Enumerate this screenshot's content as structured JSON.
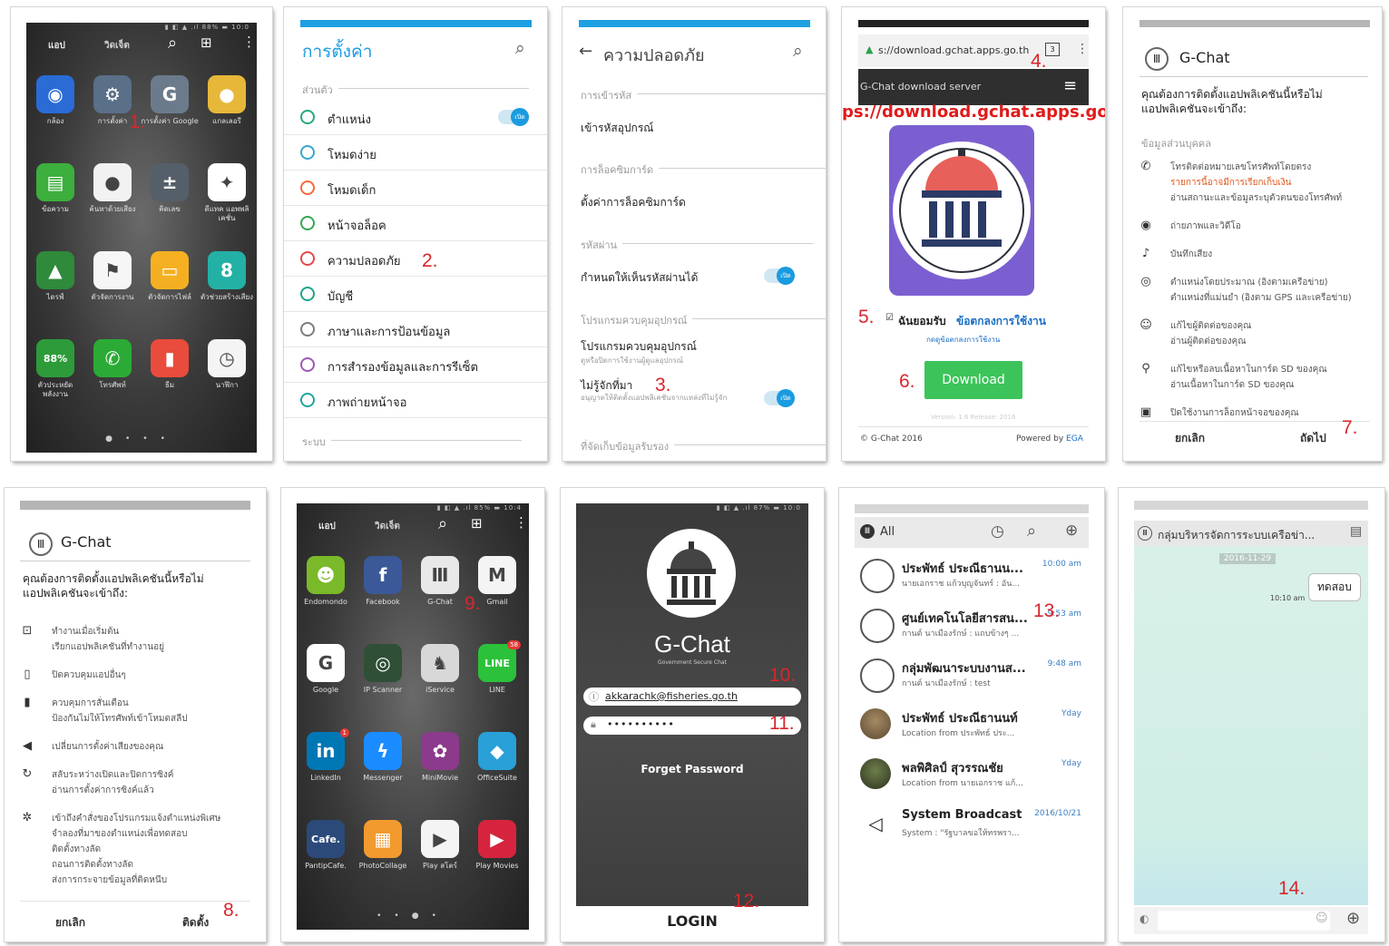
{
  "steps": {
    "s1": "1.",
    "s2": "2.",
    "s3": "3.",
    "s4": "4.",
    "s5": "5.",
    "s6": "6.",
    "s7": "7.",
    "s8": "8.",
    "s9": "9.",
    "s10": "10.",
    "s11": "11.",
    "s12": "12.",
    "s13": "13.",
    "s14": "14."
  },
  "launcher1": {
    "tab_apps": "แอป",
    "tab_widgets": "วิดเจ็ต",
    "apps": [
      {
        "label": "กล้อง",
        "color": "#2a6bd6",
        "glyph": "◉"
      },
      {
        "label": "การตั้งค่า",
        "color": "#5a6f88",
        "glyph": "⚙"
      },
      {
        "label": "การตั้งค่า Google",
        "color": "#6b7b8c",
        "glyph": "G"
      },
      {
        "label": "แกลเลอรี",
        "color": "#e7b73a",
        "glyph": "●"
      },
      {
        "label": "ข้อความ",
        "color": "#3daf3d",
        "glyph": "▤"
      },
      {
        "label": "ค้นหาด้วยเสียง",
        "color": "#f2f2f2",
        "glyph": "●"
      },
      {
        "label": "คิดเลข",
        "color": "#555f6a",
        "glyph": "±"
      },
      {
        "label": "ดีแทค แอพพลิเคชั่น",
        "color": "#ffffff",
        "glyph": "✦"
      },
      {
        "label": "ไดรฟ์",
        "color": "#2f8a3b",
        "glyph": "▲"
      },
      {
        "label": "ตัวจัดการงาน",
        "color": "#f6f6f6",
        "glyph": "⚑"
      },
      {
        "label": "ตัวจัดการไฟล์",
        "color": "#f5b021",
        "glyph": "▭"
      },
      {
        "label": "ตัวช่วยสร้างเสียง",
        "color": "#23b0a5",
        "glyph": "8"
      },
      {
        "label": "ตัวประหยัดพลังงาน",
        "color": "#2d9b3a",
        "glyph": "88%"
      },
      {
        "label": "โทรศัพท์",
        "color": "#2bab35",
        "glyph": "✆"
      },
      {
        "label": "ธีม",
        "color": "#e94b3c",
        "glyph": "▮"
      },
      {
        "label": "นาฬิกา",
        "color": "#f4f4f4",
        "glyph": "◷"
      }
    ]
  },
  "settings": {
    "title": "การตั้งค่า",
    "section_personal": "ส่วนตัว",
    "section_system": "ระบบ",
    "toggle_on": "เปิด",
    "rows": [
      {
        "label": "ตำแหน่ง",
        "color": "#27a87e"
      },
      {
        "label": "โหมดง่าย",
        "color": "#3aa6cc"
      },
      {
        "label": "โหมดเด็ก",
        "color": "#f36b3d"
      },
      {
        "label": "หน้าจอล็อค",
        "color": "#34a853"
      },
      {
        "label": "ความปลอดภัย",
        "color": "#e6474d"
      },
      {
        "label": "บัญชี",
        "color": "#1ea38a"
      },
      {
        "label": "ภาษาและการป้อนข้อมูล",
        "color": "#7d7d7d"
      },
      {
        "label": "การสำรองข้อมูลและการรีเซ็ต",
        "color": "#9b59b6"
      },
      {
        "label": "ภาพถ่ายหน้าจอ",
        "color": "#1fa6a0"
      }
    ]
  },
  "security": {
    "title": "ความปลอดภัย",
    "sec_encrypt": "การเข้ารหัส",
    "encrypt_item": "เข้ารหัสอุปกรณ์",
    "sec_simlock": "การล็อคซิมการ์ด",
    "simlock_item": "ตั้งค่าการล็อคซิมการ์ด",
    "sec_password": "รหัสผ่าน",
    "password_item": "กำหนดให้เห็นรหัสผ่านได้",
    "sec_admin": "โปรแกรมควบคุมอุปกรณ์",
    "admin_item": "โปรแกรมควบคุมอุปกรณ์",
    "admin_sub": "ดูหรือปิดการใช้งานผู้ดูแลอุปกรณ์",
    "unknown_item": "ไม่รู้จักที่มา",
    "unknown_sub": "อนุญาตให้ติดตั้งแอปพลิเคชันจากแหล่งที่ไม่รู้จัก",
    "sec_storage": "ที่จัดเก็บข้อมูลรับรอง",
    "toggle_on": "เปิด"
  },
  "browser": {
    "url": "s://download.gchat.apps.go.th",
    "tabs_count": "3",
    "site_header": "G-Chat download server",
    "annotation_url": "https://download.gchat.apps.go.th",
    "accept_label": "ฉันยอมรับ",
    "terms_link": "ข้อตกลงการใช้งาน",
    "terms_sub": "กดดูข้อตกลงการใช้งาน",
    "download_button": "Download",
    "version": "Version: 1.6 Release: 2016",
    "footer_left": "© G-Chat 2016",
    "footer_right_prefix": "Powered by ",
    "footer_right_link": "EGA"
  },
  "install1": {
    "app_name": "G-Chat",
    "question": "คุณต้องการติดตั้งแอปพลิเคชันนี้หรือไม่ แอปพลิเคชันจะเข้าถึง:",
    "section": "ข้อมูลส่วนบุคคล",
    "items": [
      {
        "icon": "phone-icon",
        "glyph": "✆",
        "lines": [
          "โทรติดต่อหมายเลขโทรศัพท์โดยตรง",
          "รายการนี้อาจมีการเรียกเก็บเงิน",
          "อ่านสถานะและข้อมูลระบุตัวตนของโทรศัพท์"
        ]
      },
      {
        "icon": "camera-icon",
        "glyph": "◉",
        "lines": [
          "ถ่ายภาพและวิดีโอ"
        ]
      },
      {
        "icon": "microphone-icon",
        "glyph": "♪",
        "lines": [
          "บันทึกเสียง"
        ]
      },
      {
        "icon": "location-icon",
        "glyph": "◎",
        "lines": [
          "ตำแหน่งโดยประมาณ (อิงตามเครือข่าย)",
          "ตำแหน่งที่แม่นยำ (อิงตาม GPS และเครือข่าย)"
        ]
      },
      {
        "icon": "contacts-icon",
        "glyph": "☺",
        "lines": [
          "แก้ไขผู้ติดต่อของคุณ",
          "อ่านผู้ติดต่อของคุณ"
        ]
      },
      {
        "icon": "usb-icon",
        "glyph": "⚲",
        "lines": [
          "แก้ไขหรือลบเนื้อหาในการ์ด SD ของคุณ",
          "อ่านเนื้อหาในการ์ด SD ของคุณ"
        ]
      },
      {
        "icon": "lock-icon",
        "glyph": "▣",
        "lines": [
          "ปิดใช้งานการล็อกหน้าจอของคุณ"
        ]
      }
    ],
    "cancel": "ยกเลิก",
    "next": "ถัดไป"
  },
  "install2": {
    "app_name": "G-Chat",
    "question": "คุณต้องการติดตั้งแอปพลิเคชันนี้หรือไม่ แอปพลิเคชันจะเข้าถึง:",
    "items": [
      {
        "icon": "startup-icon",
        "glyph": "⊡",
        "lines": [
          "ทำงานเมื่อเริ่มต้น",
          "เรียกแอปพลิเคชันที่ทำงานอยู่"
        ]
      },
      {
        "icon": "phone-device-icon",
        "glyph": "▯",
        "lines": [
          "ปิดควบคุมแอปอื่นๆ"
        ]
      },
      {
        "icon": "lock-icon",
        "glyph": "▮",
        "lines": [
          "ควบคุมการสั่นเตือน",
          "ป้องกันไม่ให้โทรศัพท์เข้าโหมดสลีป"
        ]
      },
      {
        "icon": "volume-icon",
        "glyph": "◀",
        "lines": [
          "เปลี่ยนการตั้งค่าเสียงของคุณ"
        ]
      },
      {
        "icon": "sync-icon",
        "glyph": "↻",
        "lines": [
          "สลับระหว่างเปิดและปิดการซิงค์",
          "อ่านการตั้งค่าการซิงค์แล้ว"
        ]
      },
      {
        "icon": "gear-icon",
        "glyph": "✲",
        "lines": [
          "เข้าถึงคำสั่งของโปรแกรมแจ้งตำแหน่งพิเศษ",
          "จำลองที่มาของตำแหน่งเพื่อทดสอบ",
          "ติดตั้งทางลัด",
          "ถอนการติดตั้งทางลัด",
          "ส่งการกระจายข้อมูลที่ติดหนึบ"
        ]
      }
    ],
    "cancel": "ยกเลิก",
    "install": "ติดตั้ง"
  },
  "launcher2": {
    "tab_apps": "แอป",
    "tab_widgets": "วิดเจ็ต",
    "apps": [
      {
        "label": "Endomondo",
        "color": "#7ab929",
        "glyph": "☻"
      },
      {
        "label": "Facebook",
        "color": "#3b5998",
        "glyph": "f"
      },
      {
        "label": "G-Chat",
        "color": "#e8e8e8",
        "glyph": "Ⅲ"
      },
      {
        "label": "Gmail",
        "color": "#f4f4f4",
        "glyph": "M"
      },
      {
        "label": "Google",
        "color": "#ffffff",
        "glyph": "G"
      },
      {
        "label": "IP Scanner",
        "color": "#2f4f36",
        "glyph": "◎"
      },
      {
        "label": "iService",
        "color": "#d8d8d8",
        "glyph": "♞"
      },
      {
        "label": "LINE",
        "color": "#2cc13a",
        "glyph": "LINE",
        "badge": "58"
      },
      {
        "label": "LinkedIn",
        "color": "#0077b5",
        "glyph": "in",
        "badge": "1"
      },
      {
        "label": "Messenger",
        "color": "#1a8cff",
        "glyph": "ϟ"
      },
      {
        "label": "MiniMovie",
        "color": "#8c3a8c",
        "glyph": "✿"
      },
      {
        "label": "OfficeSuite",
        "color": "#2aa0d8",
        "glyph": "◆"
      },
      {
        "label": "PantipCafe.",
        "color": "#2b4a7a",
        "glyph": "Cafe."
      },
      {
        "label": "PhotoCollage",
        "color": "#f29a2e",
        "glyph": "▦"
      },
      {
        "label": "Play สโตร์",
        "color": "#f4f4f4",
        "glyph": "▶"
      },
      {
        "label": "Play Movies",
        "color": "#d6243e",
        "glyph": "▶"
      }
    ]
  },
  "login": {
    "app_title": "G-Chat",
    "tagline": "Government Secure Chat",
    "email": "akkarachk@fisheries.go.th",
    "password_mask": "••••••••••",
    "forget": "Forget Password",
    "login": "LOGIN"
  },
  "chatlist": {
    "filter": "All",
    "rows": [
      {
        "name": "ประพัทธ์ ประณีธานน...",
        "preview": "นายเอกราช แก้วบุญจันทร์ : อัน...",
        "time": "10:00 am",
        "avatar": "group"
      },
      {
        "name": "ศูนย์เทคโนโลยีสารสน...",
        "preview": "กานต์ นาเมืองรักษ์ : แถบข้างๆ ...",
        "time": "9:53 am",
        "avatar": "group"
      },
      {
        "name": "กลุ่มพัฒนาระบบงานส...",
        "preview": "กานต์ นาเมืองรักษ์ : test",
        "time": "9:48 am",
        "avatar": "group"
      },
      {
        "name": "ประพัทธ์ ประณีธานนท์",
        "preview": "Location from ประพัทธ์ ประ...",
        "time": "Yday",
        "avatar": "photo1"
      },
      {
        "name": "พลพิศิลป์ สุวรรณชัย",
        "preview": "Location from นายเอกราช แก้...",
        "time": "Yday",
        "avatar": "photo2"
      },
      {
        "name": "System Broadcast",
        "preview": "System : \"รัฐบาลขอให้ทรพรา...",
        "time": "2016/10/21",
        "avatar": "megaphone"
      }
    ]
  },
  "chat": {
    "title": "กลุ่มบริหารจัดการระบบเครือข่า...",
    "date": "2016-11-29",
    "message": "ทดสอบ",
    "time": "10:10 am"
  },
  "colors": {
    "accent": "#1a9be0",
    "step_red": "#d8262c",
    "download_green": "#3cc45a",
    "gchat_purple": "#7b5fd1"
  }
}
